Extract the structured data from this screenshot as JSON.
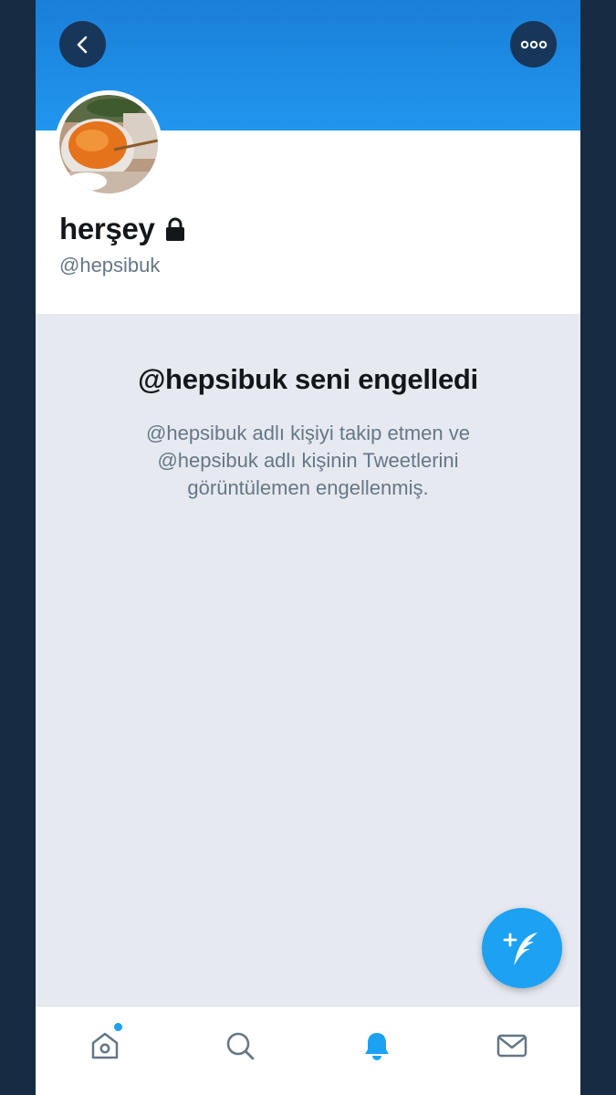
{
  "profile": {
    "name": "herşey",
    "handle": "@hepsibuk"
  },
  "blocked": {
    "title": "@hepsibuk seni engelledi",
    "description": "@hepsibuk adlı kişiyi takip etmen ve @hepsibuk adlı kişinin Tweetlerini görüntülemen engellenmiş."
  },
  "header": {
    "back_icon": "chevron-left-icon",
    "more_icon": "more-horizontal-icon"
  },
  "fab": {
    "icon": "compose-tweet-icon"
  },
  "tabbar": {
    "items": [
      {
        "name": "home",
        "icon": "home-icon",
        "has_notification_dot": true
      },
      {
        "name": "search",
        "icon": "search-icon"
      },
      {
        "name": "notifications",
        "icon": "bell-icon",
        "active": true
      },
      {
        "name": "messages",
        "icon": "mail-icon"
      }
    ]
  },
  "colors": {
    "accent": "#1da1f2",
    "banner": "#1a8ce6",
    "header_button": "#17365a",
    "background": "#e6e9f0",
    "text_primary": "#14171a",
    "text_secondary": "#657786",
    "outer": "#172b42"
  }
}
